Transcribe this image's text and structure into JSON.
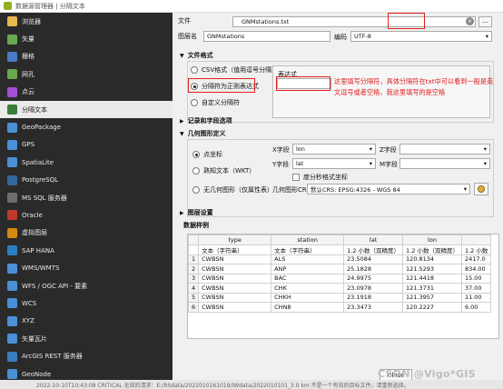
{
  "window": {
    "title": "数据源管理器 | 分隔文本"
  },
  "sidebar": {
    "items": [
      {
        "label": "浏览器",
        "icon": "folder-icon",
        "color": "#e6b84d"
      },
      {
        "label": "矢量",
        "icon": "vector-icon",
        "color": "#6aa84f"
      },
      {
        "label": "栅格",
        "icon": "raster-icon",
        "color": "#4a7bc8"
      },
      {
        "label": "网孔",
        "icon": "mesh-icon",
        "color": "#6aa84f"
      },
      {
        "label": "点云",
        "icon": "point-cloud-icon",
        "color": "#a14ed6"
      },
      {
        "label": "分隔文本",
        "icon": "delimited-text-icon",
        "color": "#3a7d3a"
      },
      {
        "label": "GeoPackage",
        "icon": "geopackage-icon",
        "color": "#4a90d9"
      },
      {
        "label": "GPS",
        "icon": "gps-icon",
        "color": "#4a90d9"
      },
      {
        "label": "SpatiaLite",
        "icon": "spatialite-icon",
        "color": "#4a90d9"
      },
      {
        "label": "PostgreSQL",
        "icon": "postgresql-icon",
        "color": "#336699"
      },
      {
        "label": "MS SQL 服务器",
        "icon": "mssql-icon",
        "color": "#6e6e6e"
      },
      {
        "label": "Oracle",
        "icon": "oracle-icon",
        "color": "#c0392b"
      },
      {
        "label": "虚拟图层",
        "icon": "virtual-layer-icon",
        "color": "#d68910"
      },
      {
        "label": "SAP HANA",
        "icon": "sap-hana-icon",
        "color": "#2a7fc4"
      },
      {
        "label": "WMS/WMTS",
        "icon": "wms-icon",
        "color": "#4a90d9"
      },
      {
        "label": "WFS / OGC API - 要素",
        "icon": "wfs-icon",
        "color": "#4a90d9"
      },
      {
        "label": "WCS",
        "icon": "wcs-icon",
        "color": "#4a90d9"
      },
      {
        "label": "XYZ",
        "icon": "xyz-icon",
        "color": "#4a90d9"
      },
      {
        "label": "矢量瓦片",
        "icon": "vector-tile-icon",
        "color": "#4a90d9"
      },
      {
        "label": "ArcGIS REST 服务器",
        "icon": "arcgis-icon",
        "color": "#3a7dc4"
      },
      {
        "label": "GeoNode",
        "icon": "geonode-icon",
        "color": "#4a90d9"
      }
    ],
    "selected_index": 5
  },
  "form": {
    "file_label": "文件",
    "file_value": "GNMstations.txt",
    "layer_name_label": "图层名",
    "layer_name_value": "GNMstations",
    "encoding_label": "编码",
    "encoding_value": "UTF-8"
  },
  "file_format": {
    "header": "文件格式",
    "options": [
      "CSV格式（值用逗号分隔）",
      "分隔符为正则表达式",
      "自定义分隔符"
    ],
    "selected_index": 1,
    "regex_label": "表达式",
    "regex_value": ""
  },
  "annotation": {
    "text": "这里填写分隔符，具体分隔符在txt中可以看到一般是英文逗号或者空格，我这里填写的是空格"
  },
  "record_fields": {
    "header": "记录和字段选项"
  },
  "geometry": {
    "header": "几何图形定义",
    "options": [
      "点坐标",
      "熟知文本（WKT）",
      "无几何图形（仅属性表）"
    ],
    "selected_index": 0,
    "x_label": "X字段",
    "x_value": "lon",
    "y_label": "Y字段",
    "y_value": "lat",
    "z_label": "Z字段",
    "z_value": "",
    "m_label": "M字段",
    "m_value": "",
    "dms_label": "度分秒格式坐标",
    "crs_label": "几何图形CRS",
    "crs_value": "默认CRS: EPSG:4326 - WGS 84"
  },
  "layer_settings": {
    "header": "图层设置"
  },
  "sample": {
    "header": "数据样例",
    "columns": [
      "type",
      "station",
      "lat",
      "lon"
    ],
    "type_row": [
      "文本（字符串）",
      "文本（字符串）",
      "1.2 小数（双精度）",
      "1.2 小数（双精度）",
      "1.2 小数"
    ],
    "rows": [
      [
        "1",
        "CWBSN",
        "ALS",
        "23.5084",
        "120.8134",
        "2417.0"
      ],
      [
        "2",
        "CWBSN",
        "ANP",
        "25.1828",
        "121.5293",
        "834.00"
      ],
      [
        "3",
        "CWBSN",
        "BAC",
        "24.9975",
        "121.4418",
        "15.00"
      ],
      [
        "4",
        "CWBSN",
        "CHK",
        "23.0978",
        "121.3731",
        "37.00"
      ],
      [
        "5",
        "CWBSN",
        "CHKH",
        "23.1918",
        "121.3957",
        "11.00"
      ],
      [
        "6",
        "CWBSN",
        "CHN8",
        "23.3473",
        "120.2227",
        "6.00"
      ]
    ]
  },
  "footer": {
    "close_label": "Close",
    "watermark": "CSDN @Vigo*GIS"
  },
  "statusbar": {
    "text": "2022-10-10T10:43:08    CRITICAL    无效的请求：E:/RSdata/2022010161019/IWdata/2022010101_3.0 km 不是一个有效的目标文件。请重新选择。"
  }
}
